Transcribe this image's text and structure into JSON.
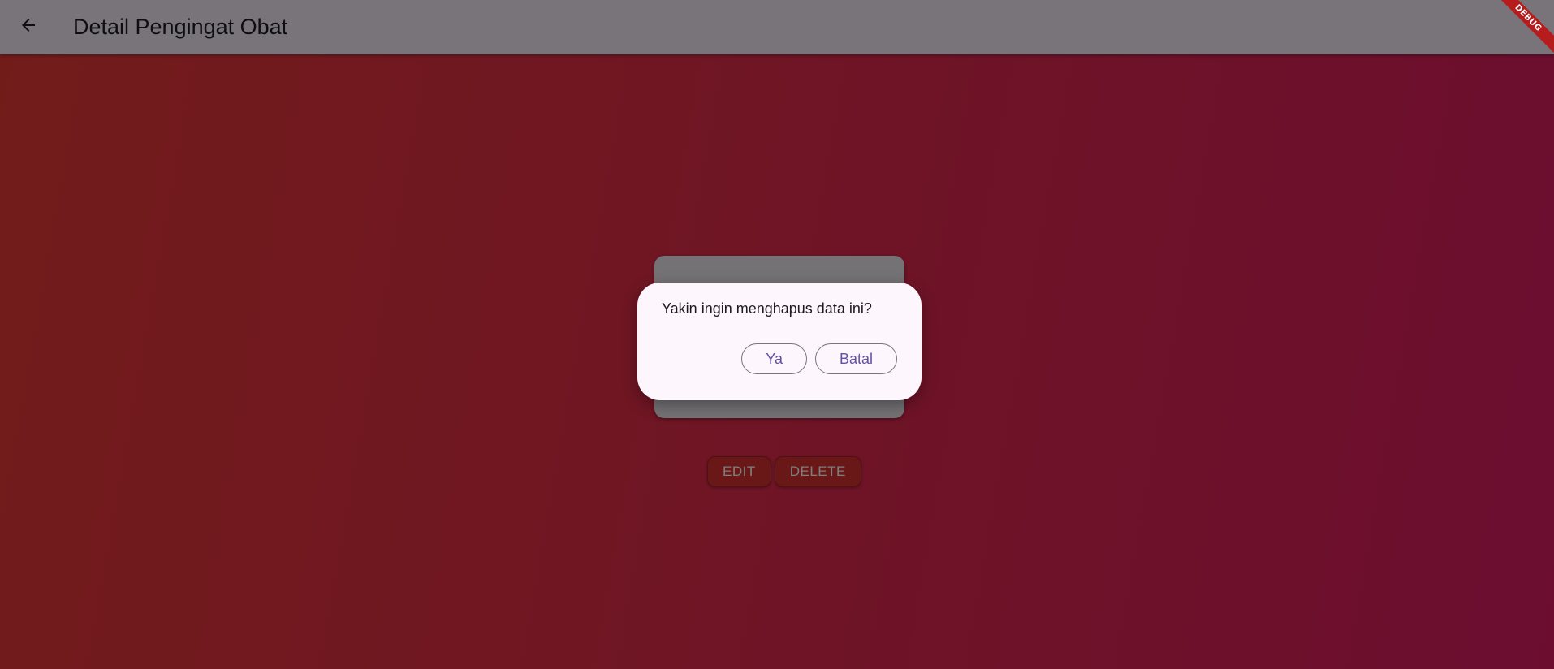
{
  "appbar": {
    "back_icon": "arrow-back-icon",
    "title": "Detail Pengingat Obat"
  },
  "debug_banner": {
    "label": "DEBUG"
  },
  "actions": {
    "edit_label": "EDIT",
    "delete_label": "DELETE"
  },
  "dialog": {
    "message": "Yakin ingin menghapus data ini?",
    "confirm_label": "Ya",
    "cancel_label": "Batal"
  },
  "colors": {
    "background_start": "#e53935",
    "background_end": "#d81b60",
    "appbar": "#f1e9f3",
    "dialog": "#fdf6fd",
    "button_text": "#6750a4",
    "action_button": "#d32f2f"
  }
}
